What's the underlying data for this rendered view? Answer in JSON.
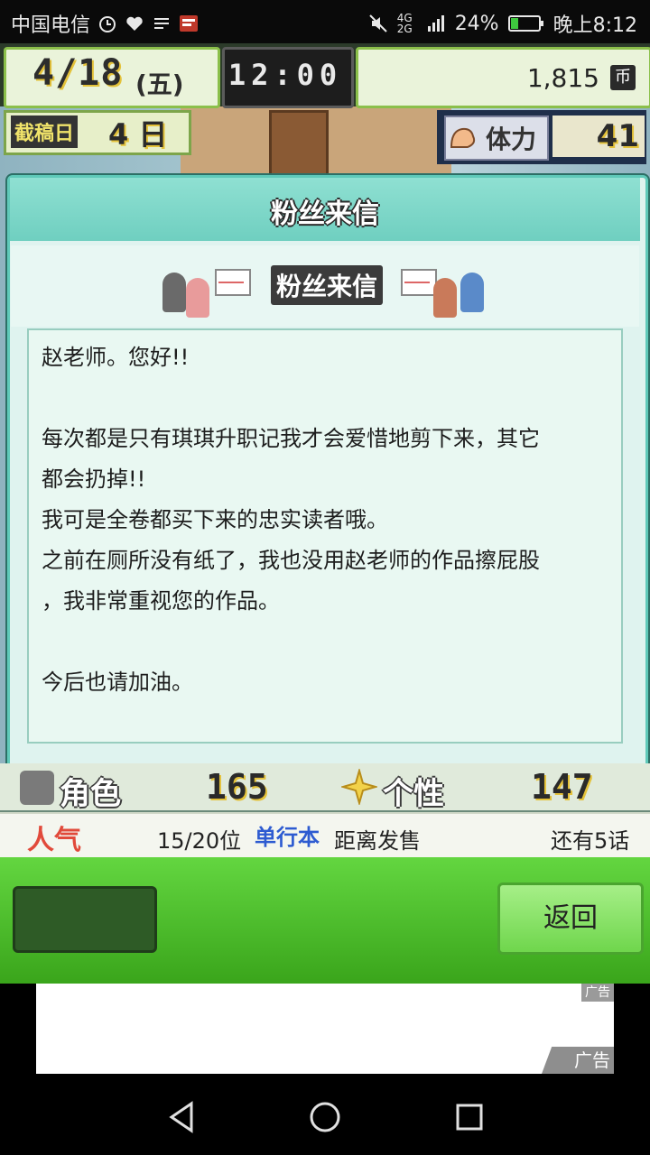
{
  "status_bar": {
    "carrier": "中国电信",
    "battery": "24%",
    "time": "晚上8:12",
    "network": "4G 2G",
    "icons": [
      "alarm-icon",
      "heartrate-icon",
      "app-icon",
      "news-app-icon",
      "mute-icon",
      "signal-icon",
      "battery-icon"
    ]
  },
  "hud": {
    "date": "4/18",
    "weekday": "(五)",
    "clock": "12:00",
    "money": "1,815",
    "money_unit": "币",
    "deadline_label": "截稿日",
    "deadline_value": "4 日",
    "stamina_label": "体力",
    "stamina_value": "41"
  },
  "dialog": {
    "title": "粉丝来信",
    "banner_title": "粉丝来信",
    "letter_lines": [
      "赵老师。您好!!",
      "",
      "每次都是只有琪琪升职记我才会爱惜地剪下来，其它",
      "都会扔掉!!",
      "我可是全卷都买下来的忠实读者哦。",
      "之前在厕所没有纸了，我也没用赵老师的作品擦屁股",
      "，我非常重视您的作品。",
      "",
      "今后也请加油。"
    ]
  },
  "stats": {
    "role_label": "角色",
    "role_value": "165",
    "personality_label": "个性",
    "personality_value": "147"
  },
  "ranking": {
    "label": "人气",
    "value": "15/20位",
    "tag": "单行本",
    "distance_label": "距离发售",
    "remaining": "还有5话"
  },
  "buttons": {
    "back_label": "返回"
  },
  "ad": {
    "tag": "广告",
    "badge": "广告"
  },
  "colors": {
    "accent_teal": "#5fc9b9",
    "green": "#4ebe2c",
    "popularity_red": "#e14a3b",
    "single_blue": "#2d5bd1"
  }
}
